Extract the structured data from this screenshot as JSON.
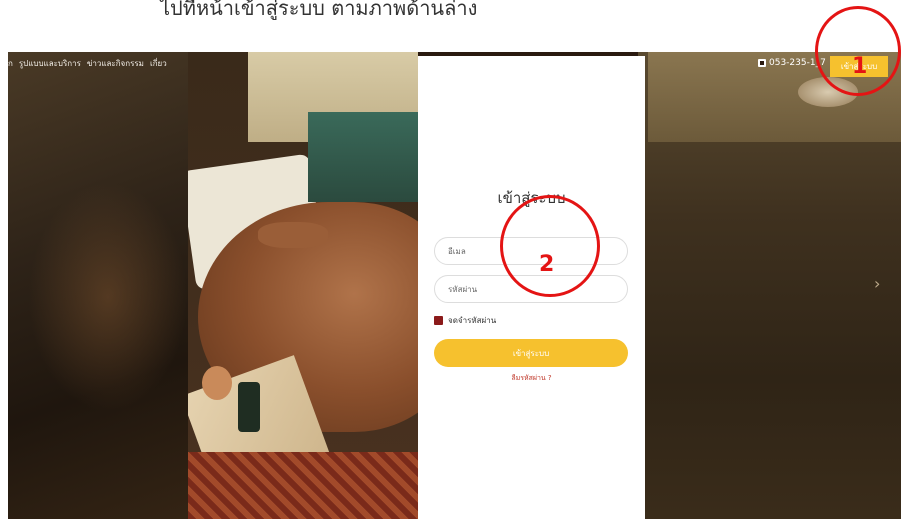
{
  "caption": {
    "text": "ไปที่หน้าเข้าสู่ระบบ ตามภาพด้านล่าง"
  },
  "nav": {
    "items": [
      "ก",
      "รูปแบบและบริการ",
      "ข่าวและกิจกรรม",
      "เกี่ยว"
    ]
  },
  "header": {
    "phone": "053-235-1_7",
    "phone_icon": "phone-icon",
    "login_button": "เข้าสู่ระบบ"
  },
  "login": {
    "title": "เข้าสู่ระบบ",
    "email_placeholder": "อีเมล",
    "password_placeholder": "รหัสผ่าน",
    "remember_label": "จดจำรหัสผ่าน",
    "submit_label": "เข้าสู่ระบบ",
    "forgot_label": "ลืมรหัสผ่าน ?"
  },
  "annotations": {
    "marker_1": "1",
    "marker_2": "2",
    "color": "#e41414"
  },
  "colors": {
    "accent": "#f6c12e",
    "checkbox": "#8b1a1a",
    "forgot_link": "#c0392b"
  },
  "slider": {
    "next_icon": "chevron-right-icon"
  }
}
